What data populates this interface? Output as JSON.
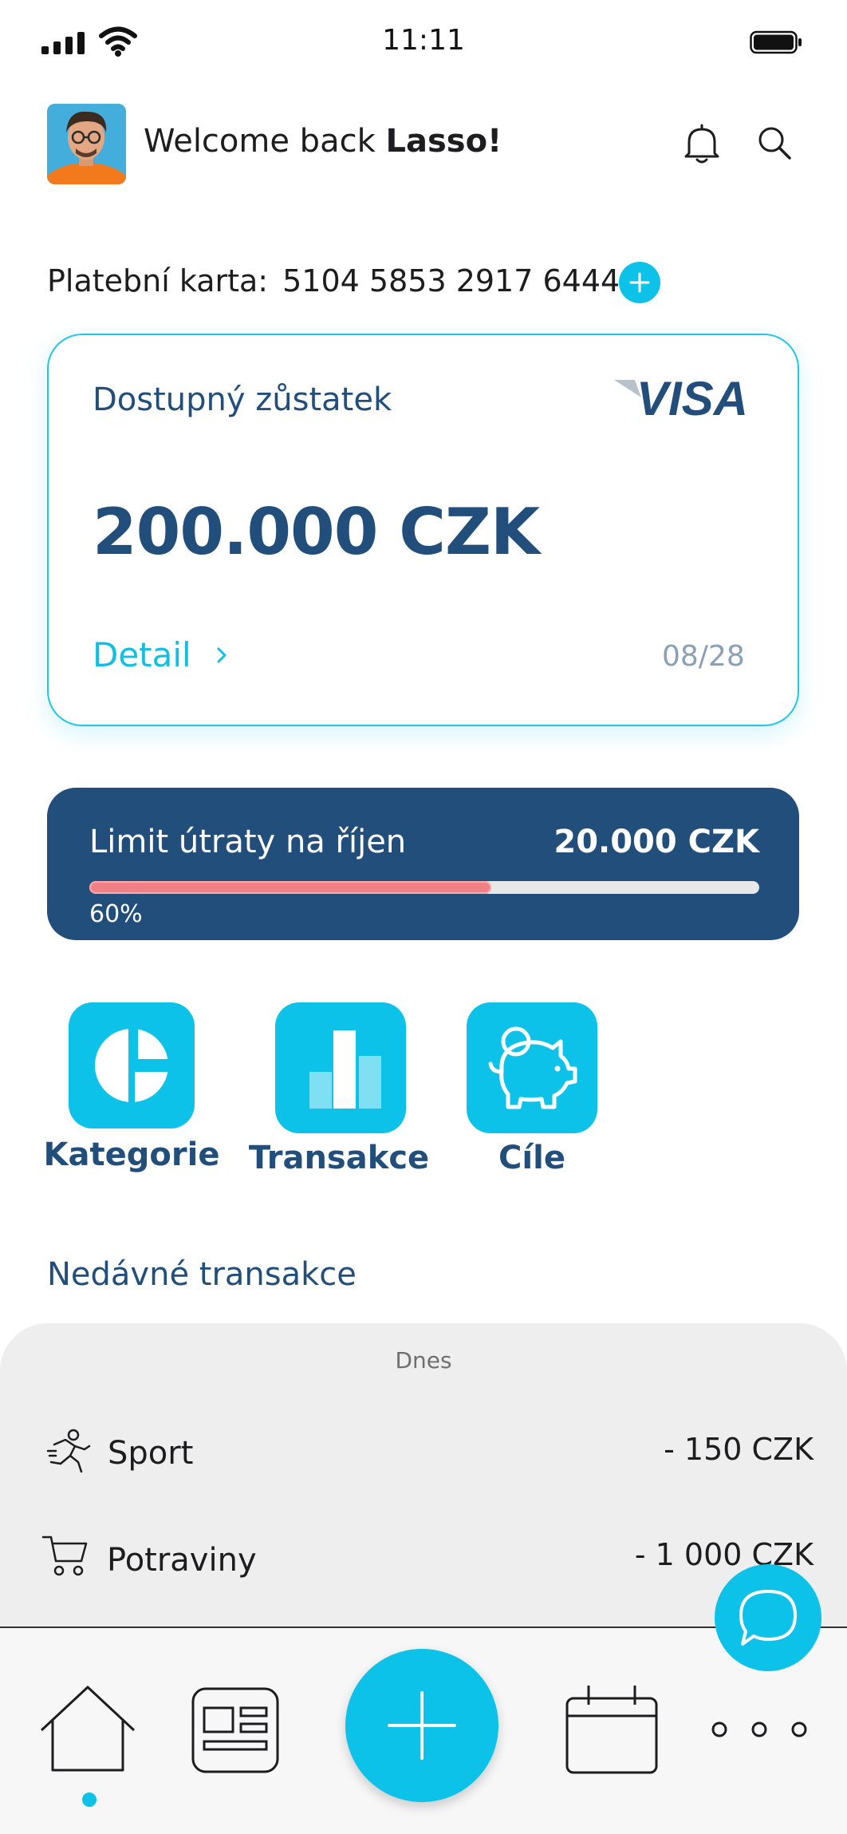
{
  "status_bar": {
    "time": "11:11"
  },
  "header": {
    "welcome_prefix": "Welcome back ",
    "user_name": "Lasso!"
  },
  "card_number": {
    "label": "Platební karta:",
    "value": "5104 5853 2917 6444"
  },
  "balance_card": {
    "label": "Dostupný zůstatek",
    "brand": "VISA",
    "amount": "200.000 CZK",
    "detail_label": "Detail",
    "expiry": "08/28"
  },
  "spending_limit": {
    "label": "Limit útraty na říjen",
    "amount": "20.000 CZK",
    "percent_label": "60%",
    "progress_fraction": 0.6
  },
  "quick_actions": [
    {
      "label": "Kategorie",
      "icon": "pie-chart-icon"
    },
    {
      "label": "Transakce",
      "icon": "bar-chart-icon"
    },
    {
      "label": "Cíle",
      "icon": "piggy-bank-icon"
    }
  ],
  "recent": {
    "title": "Nedávné transakce",
    "day_label": "Dnes",
    "transactions": [
      {
        "name": "Sport",
        "amount": "- 150 CZK",
        "icon": "running-person-icon"
      },
      {
        "name": "Potraviny",
        "amount": "- 1 000 CZK",
        "icon": "shopping-cart-icon"
      }
    ]
  },
  "bottom_nav": {
    "items": [
      {
        "icon": "home-icon"
      },
      {
        "icon": "news-icon"
      },
      {
        "icon": "plus-icon"
      },
      {
        "icon": "calendar-icon"
      },
      {
        "icon": "more-icon"
      }
    ]
  },
  "colors": {
    "accent": "#0dc2e8",
    "navy": "#214e7a",
    "progress": "#f07f86"
  }
}
